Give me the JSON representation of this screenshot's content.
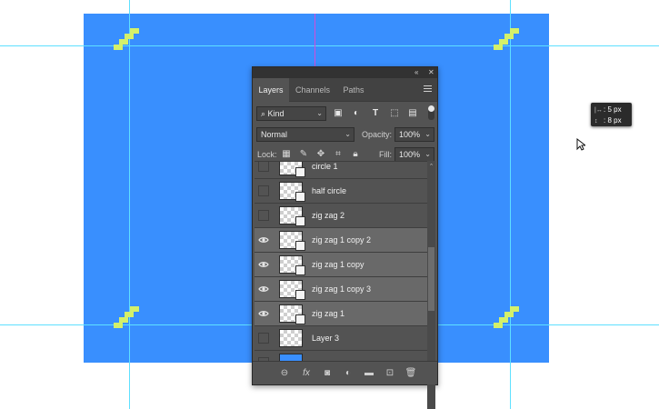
{
  "colors": {
    "artboard": "#398ffe",
    "guides": "#5ee0ff",
    "magenta_guide": "#d24bd8",
    "zigzag": "#d4f06a"
  },
  "tooltip": {
    "line1_icon": "horizontal-measure-icon",
    "line1": ": 5 px",
    "line2_icon": "vertical-measure-icon",
    "line2": ": 8 px"
  },
  "panel": {
    "title_collapse": "«",
    "title_close": "✕",
    "tabs": [
      {
        "label": "Layers",
        "active": true
      },
      {
        "label": "Channels",
        "active": false
      },
      {
        "label": "Paths",
        "active": false
      }
    ],
    "filter": {
      "kind_label": "Kind",
      "icons": [
        "image-filter-icon",
        "adjustment-filter-icon",
        "type-filter-icon",
        "shape-filter-icon",
        "smart-object-filter-icon"
      ]
    },
    "blend_mode": "Normal",
    "opacity_label": "Opacity:",
    "opacity_value": "100%",
    "lock_label": "Lock:",
    "fill_label": "Fill:",
    "fill_value": "100%",
    "layers": [
      {
        "name": "circle 1",
        "visible": false,
        "selected": false
      },
      {
        "name": "half circle",
        "visible": false,
        "selected": false
      },
      {
        "name": "zig zag 2",
        "visible": false,
        "selected": false
      },
      {
        "name": "zig zag 1 copy 2",
        "visible": true,
        "selected": true
      },
      {
        "name": "zig zag 1 copy",
        "visible": true,
        "selected": true
      },
      {
        "name": "zig zag 1 copy 3",
        "visible": true,
        "selected": true
      },
      {
        "name": "zig zag 1",
        "visible": true,
        "selected": true
      },
      {
        "name": "Layer 3",
        "visible": false,
        "selected": false
      },
      {
        "name": "",
        "visible": false,
        "selected": false
      }
    ],
    "footer_icons": [
      "link-layers-icon",
      "fx-icon",
      "add-mask-icon",
      "adjustment-layer-icon",
      "new-group-icon",
      "new-layer-icon",
      "delete-layer-icon"
    ]
  }
}
